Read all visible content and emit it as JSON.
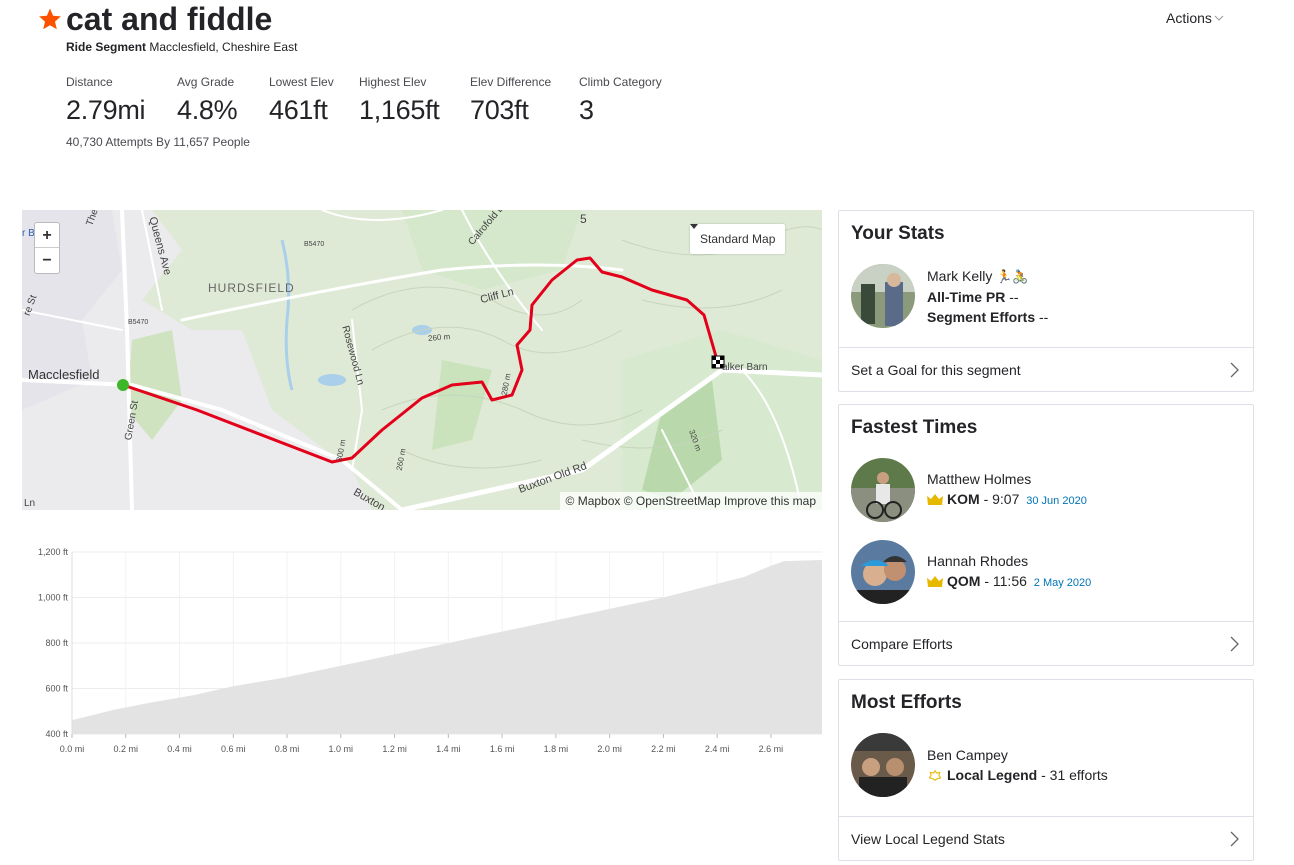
{
  "segment": {
    "title": "cat and fiddle",
    "type_label": "Ride Segment",
    "location": "Macclesfield, Cheshire East",
    "actions_label": "Actions",
    "attempts_text": "40,730 Attempts By 11,657 People"
  },
  "stats": [
    {
      "label": "Distance",
      "value": "2.79mi"
    },
    {
      "label": "Avg Grade",
      "value": "4.8%"
    },
    {
      "label": "Lowest Elev",
      "value": "461ft"
    },
    {
      "label": "Highest Elev",
      "value": "1,165ft"
    },
    {
      "label": "Elev Difference",
      "value": "703ft"
    },
    {
      "label": "Climb Category",
      "value": "3"
    }
  ],
  "map": {
    "zoom_in": "+",
    "zoom_out": "−",
    "style_label": "Standard Map",
    "attribution": "© Mapbox © OpenStreetMap Improve this map",
    "labels": {
      "macclesfield": "Macclesfield",
      "hurdsfield": "HURDSFIELD",
      "queens_ave": "Queens Ave",
      "cliff_ln": "Cliff Ln",
      "rosewood": "Rosewood Ln",
      "buxton_old_rd": "Buxton Old Rd",
      "buxton": "Buxton",
      "green_st": "Green St",
      "calrofold": "Calrofold L",
      "walker_barn": "alker Barn",
      "b5470a": "B5470",
      "b5470b": "B5470",
      "c260a": "260 m",
      "c260b": "260 m",
      "c280": "280 m",
      "c300": "300 m",
      "c320": "320 m",
      "the": "The",
      "re_st": "re St",
      "five": "5",
      "r_b": "r B",
      "ln": "Ln"
    }
  },
  "chart_data": {
    "type": "area",
    "xlabel": "",
    "ylabel": "",
    "x_ticks": [
      "0.0 mi",
      "0.2 mi",
      "0.4 mi",
      "0.6 mi",
      "0.8 mi",
      "1.0 mi",
      "1.2 mi",
      "1.4 mi",
      "1.6 mi",
      "1.8 mi",
      "2.0 mi",
      "2.2 mi",
      "2.4 mi",
      "2.6 mi"
    ],
    "y_ticks": [
      "1,200 ft",
      "1,000 ft",
      "800 ft",
      "600 ft",
      "400 ft"
    ],
    "xlim": [
      0,
      2.79
    ],
    "ylim": [
      400,
      1200
    ],
    "x": [
      0.0,
      0.05,
      0.15,
      0.3,
      0.45,
      0.6,
      0.8,
      1.0,
      1.2,
      1.4,
      1.6,
      1.8,
      2.0,
      2.2,
      2.4,
      2.5,
      2.6,
      2.65,
      2.79
    ],
    "y": [
      461,
      475,
      505,
      540,
      570,
      610,
      650,
      700,
      750,
      800,
      850,
      900,
      950,
      1000,
      1060,
      1090,
      1140,
      1160,
      1165
    ],
    "grid": true
  },
  "your_stats": {
    "title": "Your Stats",
    "name": "Mark Kelly",
    "activity_icons": "🏃🚴",
    "pr_label": "All-Time PR",
    "pr_value": "--",
    "efforts_label": "Segment Efforts",
    "efforts_value": "--",
    "link": "Set a Goal for this segment"
  },
  "fastest": {
    "title": "Fastest Times",
    "kom": {
      "name": "Matthew Holmes",
      "badge": "KOM",
      "time": "- 9:07",
      "date": "30 Jun 2020"
    },
    "qom": {
      "name": "Hannah Rhodes",
      "badge": "QOM",
      "time": "- 11:56",
      "date": "2 May 2020"
    },
    "link": "Compare Efforts"
  },
  "most_efforts": {
    "title": "Most Efforts",
    "name": "Ben Campey",
    "badge": "Local Legend",
    "count": "- 31 efforts",
    "link": "View Local Legend Stats"
  },
  "colors": {
    "brand": "#fc5200",
    "route": "#e3001b",
    "kom_gold": "#e6b800",
    "link_blue": "#0074b7"
  }
}
